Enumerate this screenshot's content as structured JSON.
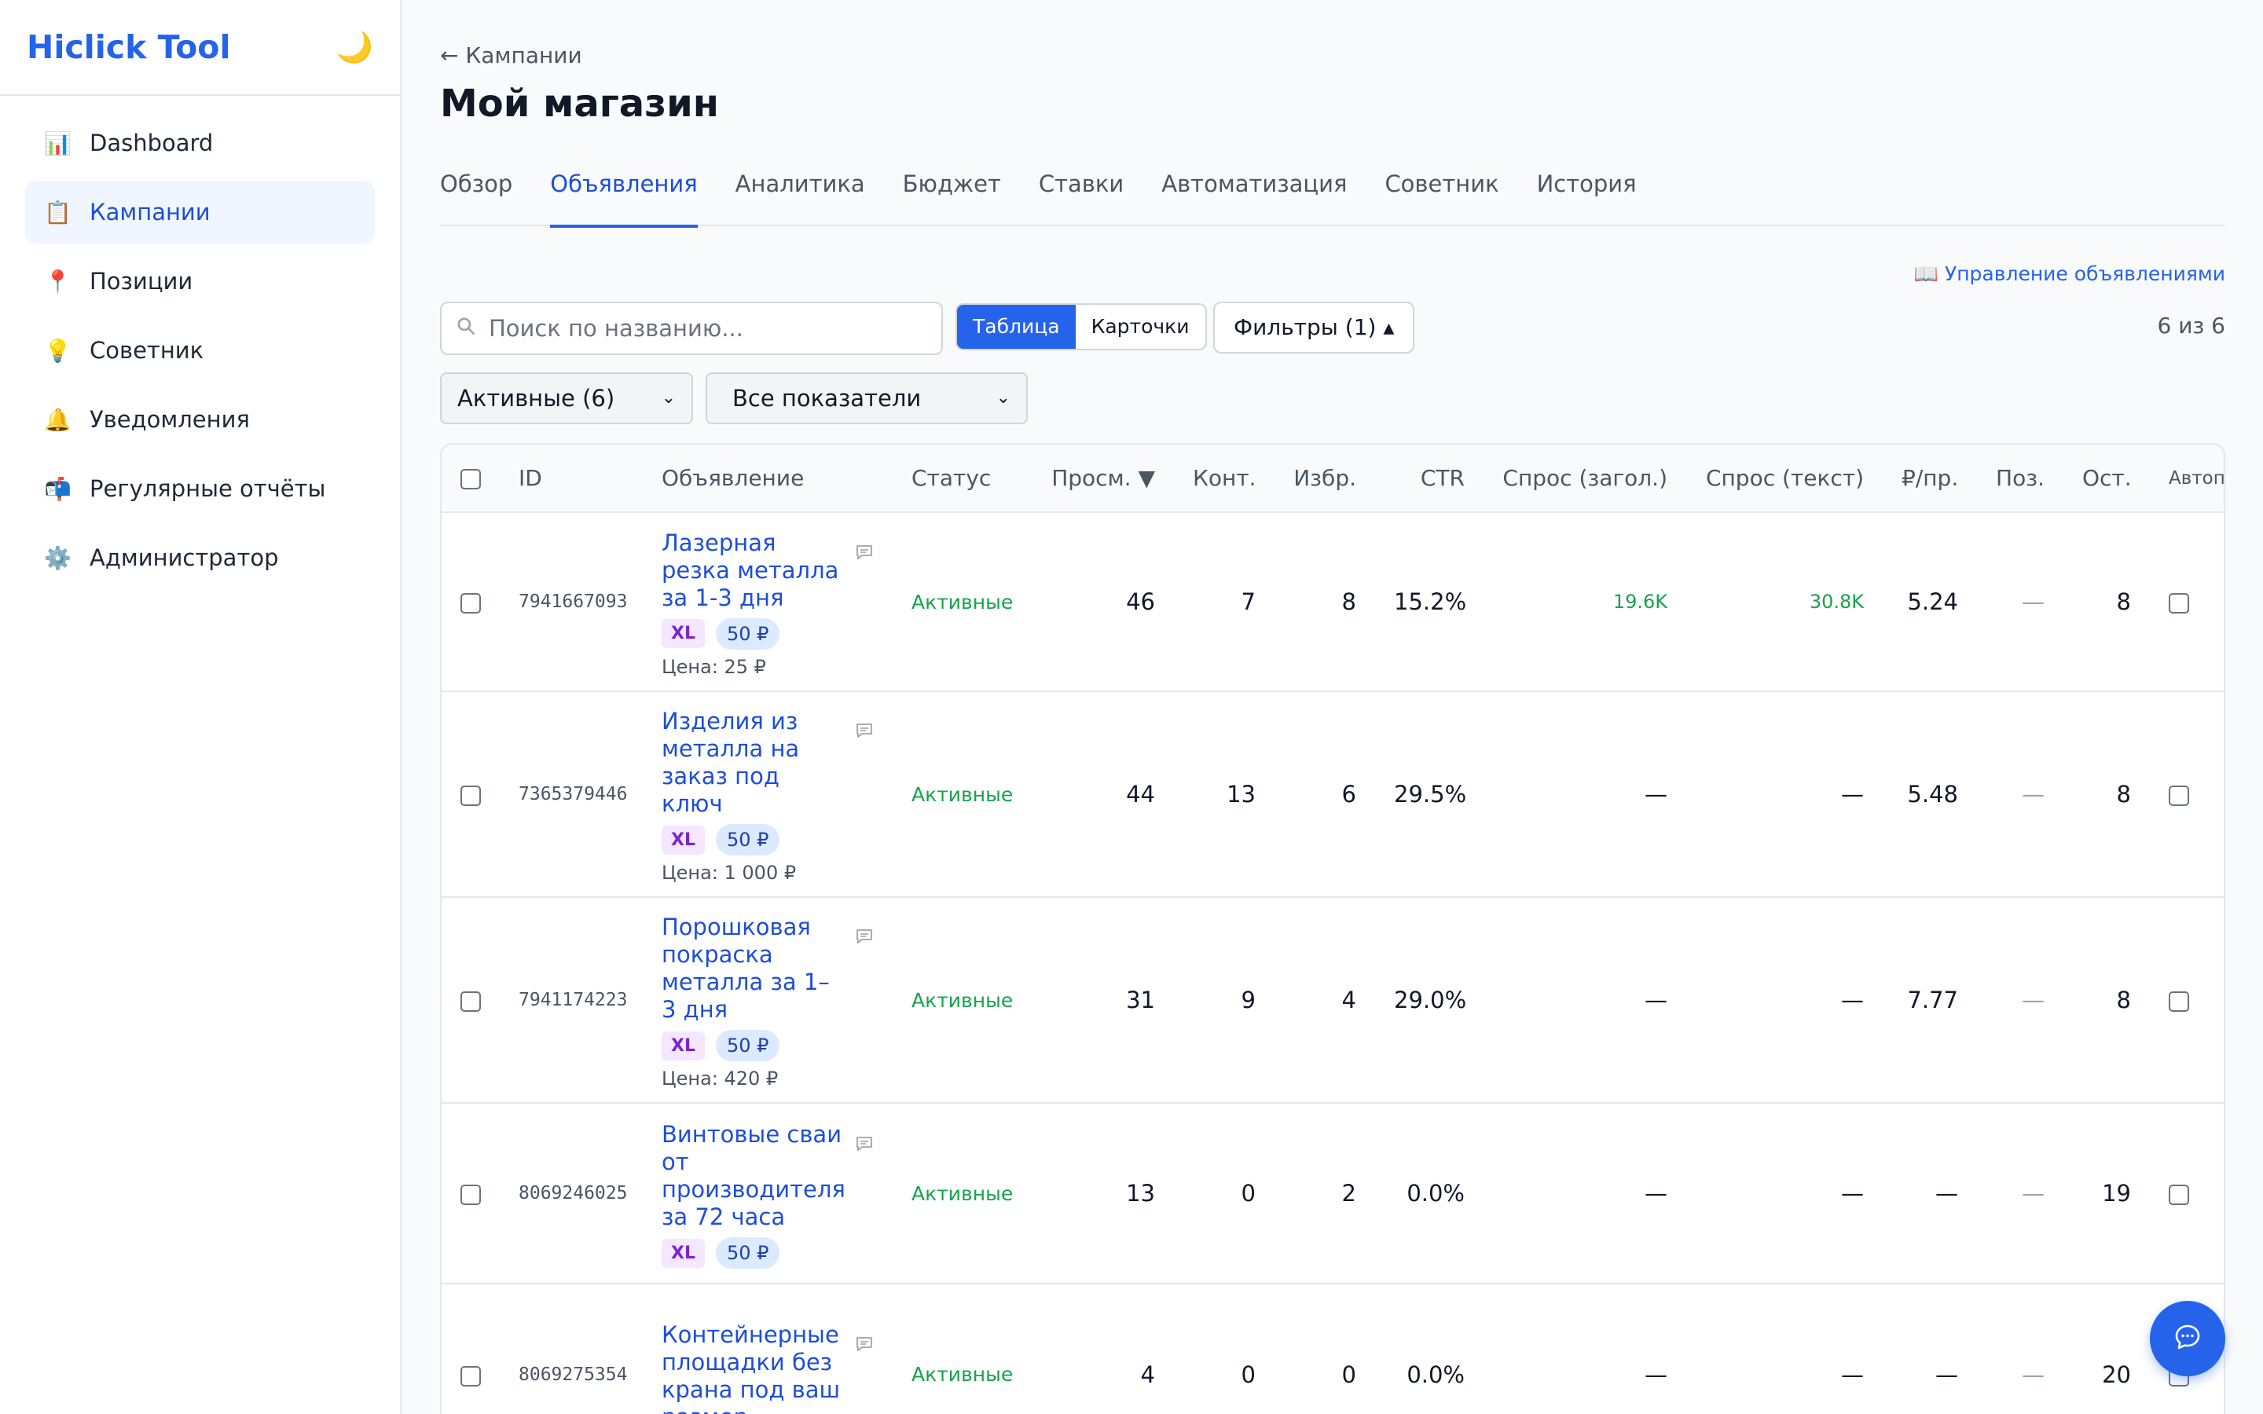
{
  "app": {
    "title": "Hiclick Tool",
    "theme_icon": "🌙"
  },
  "sidebar": {
    "items": [
      {
        "icon": "📊",
        "label": "Dashboard",
        "active": false
      },
      {
        "icon": "📋",
        "label": "Кампании",
        "active": true
      },
      {
        "icon": "📍",
        "label": "Позиции",
        "active": false
      },
      {
        "icon": "💡",
        "label": "Советник",
        "active": false
      },
      {
        "icon": "🔔",
        "label": "Уведомления",
        "active": false
      },
      {
        "icon": "📬",
        "label": "Регулярные отчёты",
        "active": false
      },
      {
        "icon": "⚙️",
        "label": "Администратор",
        "active": false
      }
    ]
  },
  "header": {
    "breadcrumb": "← Кампании",
    "title": "Мой магазин"
  },
  "tabs": [
    {
      "label": "Обзор",
      "active": false
    },
    {
      "label": "Объявления",
      "active": true
    },
    {
      "label": "Аналитика",
      "active": false
    },
    {
      "label": "Бюджет",
      "active": false
    },
    {
      "label": "Ставки",
      "active": false
    },
    {
      "label": "Автоматизация",
      "active": false
    },
    {
      "label": "Советник",
      "active": false
    },
    {
      "label": "История",
      "active": false
    }
  ],
  "toolbar": {
    "manage_link": "📖 Управление объявлениями",
    "search_placeholder": "Поиск по названию...",
    "view_table": "Таблица",
    "view_cards": "Карточки",
    "filters": "Фильтры (1) ▴",
    "count": "6 из 6",
    "status_select": "Активные (6)",
    "metrics_select": "Все показатели"
  },
  "table": {
    "columns": {
      "id": "ID",
      "ad": "Объявление",
      "status": "Статус",
      "views": "Просм. ▼",
      "contacts": "Конт.",
      "favorites": "Избр.",
      "ctr": "CTR",
      "demand_title": "Спрос (загол.)",
      "demand_text": "Спрос (текст)",
      "rub_per_view": "₽/пр.",
      "position": "Поз.",
      "remaining": "Ост.",
      "auto": "Автоп"
    },
    "rows": [
      {
        "id": "7941667093",
        "title": "Лазерная резка металла за 1-3 дня",
        "badge": "XL",
        "price_badge": "50 ₽",
        "price": "Цена: 25 ₽",
        "status": "Активные",
        "views": "46",
        "contacts": "7",
        "favorites": "8",
        "ctr": "15.2%",
        "demand_title": "19.6K",
        "demand_text": "30.8K",
        "rub_per_view": "5.24",
        "position": "—",
        "remaining": "8"
      },
      {
        "id": "7365379446",
        "title": "Изделия из металла на заказ под ключ",
        "badge": "XL",
        "price_badge": "50 ₽",
        "price": "Цена: 1 000 ₽",
        "status": "Активные",
        "views": "44",
        "contacts": "13",
        "favorites": "6",
        "ctr": "29.5%",
        "demand_title": "—",
        "demand_text": "—",
        "rub_per_view": "5.48",
        "position": "—",
        "remaining": "8"
      },
      {
        "id": "7941174223",
        "title": "Порошковая покраска металла за 1–3 дня",
        "badge": "XL",
        "price_badge": "50 ₽",
        "price": "Цена: 420 ₽",
        "status": "Активные",
        "views": "31",
        "contacts": "9",
        "favorites": "4",
        "ctr": "29.0%",
        "demand_title": "—",
        "demand_text": "—",
        "rub_per_view": "7.77",
        "position": "—",
        "remaining": "8"
      },
      {
        "id": "8069246025",
        "title": "Винтовые сваи от производителя за 72 часа",
        "badge": "XL",
        "price_badge": "50 ₽",
        "price": "",
        "status": "Активные",
        "views": "13",
        "contacts": "0",
        "favorites": "2",
        "ctr": "0.0%",
        "demand_title": "—",
        "demand_text": "—",
        "rub_per_view": "—",
        "position": "—",
        "remaining": "19"
      },
      {
        "id": "8069275354",
        "title": "Контейнерные площадки без крана под ваш размер",
        "badge": "",
        "price_badge": "",
        "price": "",
        "status": "Активные",
        "views": "4",
        "contacts": "0",
        "favorites": "0",
        "ctr": "0.0%",
        "demand_title": "—",
        "demand_text": "—",
        "rub_per_view": "—",
        "position": "—",
        "remaining": "20"
      }
    ]
  }
}
